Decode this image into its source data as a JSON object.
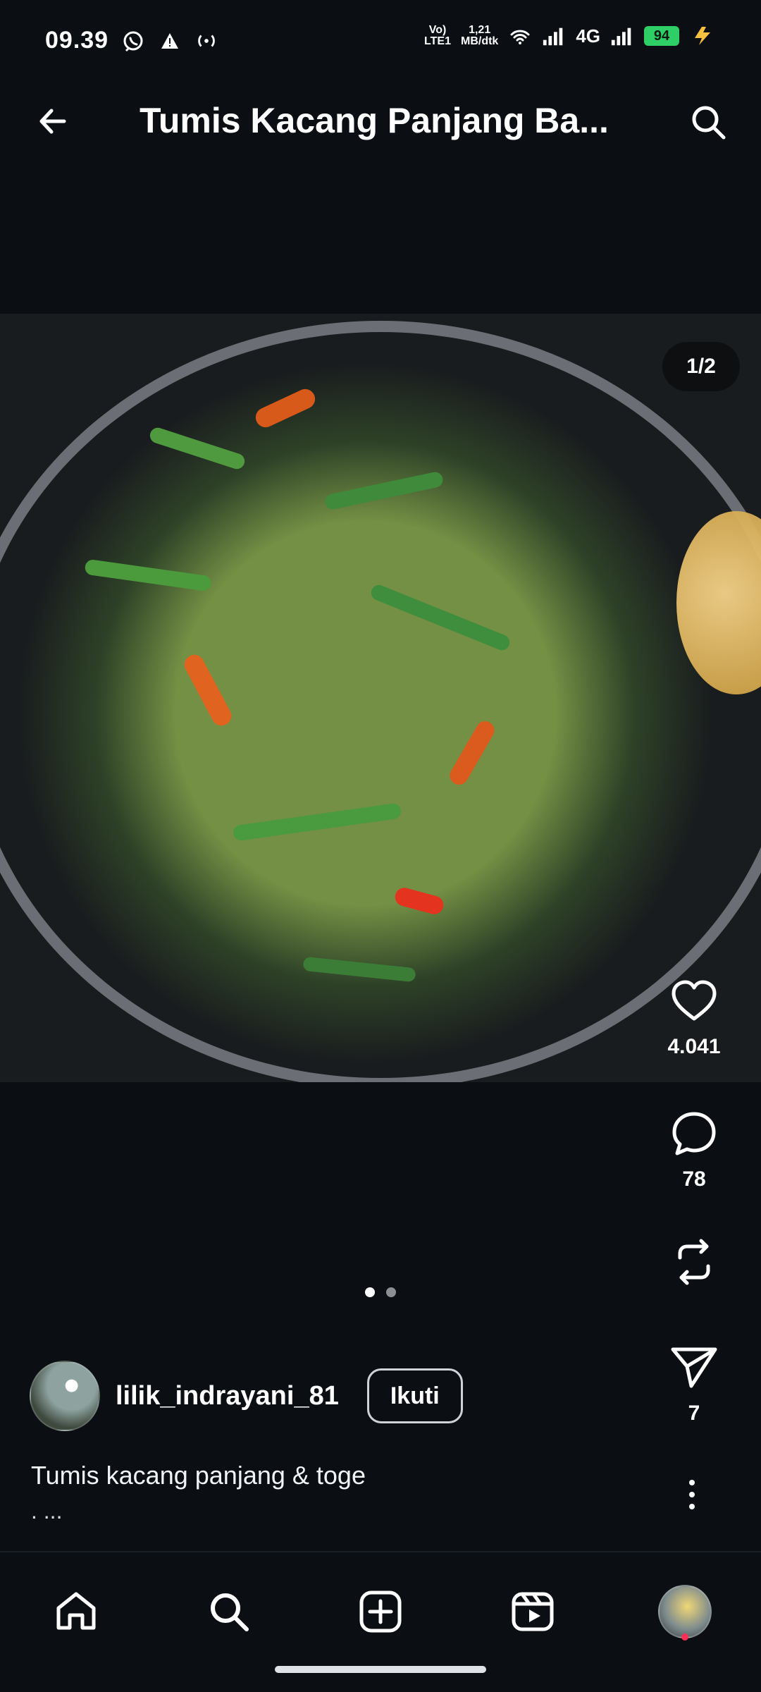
{
  "status_bar": {
    "time": "09.39",
    "network_top": "Vo)",
    "network_bottom": "LTE1",
    "speed_top": "1,21",
    "speed_bottom": "MB/dtk",
    "network_type": "4G",
    "battery": "94"
  },
  "header": {
    "title": "Tumis Kacang Panjang Ba..."
  },
  "media": {
    "counter": "1/2"
  },
  "actions": {
    "likes": "4.041",
    "comments": "78",
    "shares": "7"
  },
  "author": {
    "username": "lilik_indrayani_81",
    "follow_label": "Ikuti"
  },
  "caption": {
    "text": "Tumis kacang panjang & toge",
    "more": ". ..."
  },
  "colors": {
    "background": "#0b0f14",
    "battery": "#2fcf67",
    "notification_dot": "#ff2e55"
  }
}
